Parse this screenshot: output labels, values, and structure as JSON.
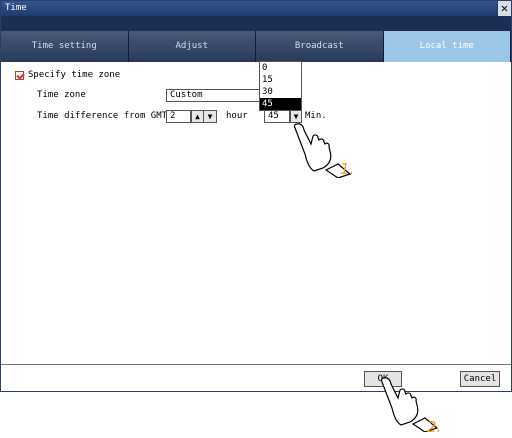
{
  "window": {
    "title": "Time",
    "close_icon": "close-icon"
  },
  "tabs": [
    {
      "label": "Time setting",
      "active": false
    },
    {
      "label": "Adjust",
      "active": false
    },
    {
      "label": "Broadcast",
      "active": false
    },
    {
      "label": "Local time",
      "active": true
    }
  ],
  "form": {
    "specify_time_zone_label": "Specify time zone",
    "specify_time_zone_checked": true,
    "time_zone_label": "Time zone",
    "time_zone_value": "Custom",
    "gmt_label": "Time difference from GMT",
    "gmt_hour_value": "2",
    "hour_unit": "hour",
    "gmt_min_value": "45",
    "min_unit": "Min.",
    "min_options": [
      "0",
      "15",
      "30",
      "45"
    ],
    "min_selected": "45"
  },
  "footer": {
    "ok_label": "OK",
    "cancel_label": "Cancel"
  },
  "annotations": {
    "step1": "1.",
    "step2": "2."
  },
  "colors": {
    "titlebar": "#1f3b6d",
    "active_tab": "#9cc6e8",
    "step_marker": "#f0a11a"
  }
}
